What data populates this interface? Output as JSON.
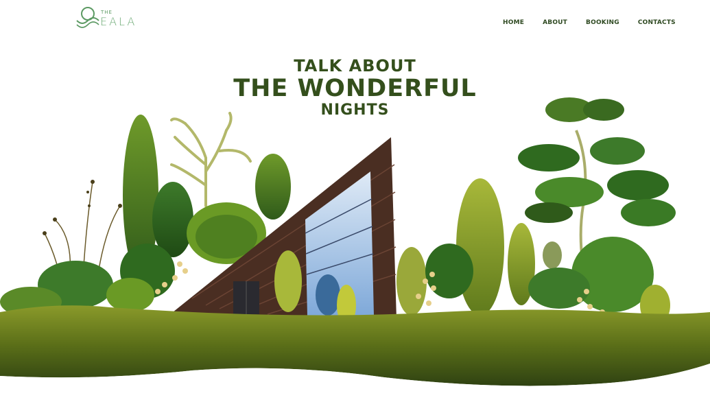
{
  "brand": {
    "small": "THE",
    "name": "EALA"
  },
  "nav": {
    "items": [
      {
        "label": "HOME"
      },
      {
        "label": "ABOUT"
      },
      {
        "label": "BOOKING"
      },
      {
        "label": "CONTACTS"
      }
    ]
  },
  "hero": {
    "line1": "TALK ABOUT",
    "line2": "THE WONDERFUL",
    "line3": "NIGHTS"
  },
  "colors": {
    "title": "#344f1c",
    "logo": "#6aa872",
    "ground": "#5f7a1c",
    "cabin": "#4a2e22"
  }
}
